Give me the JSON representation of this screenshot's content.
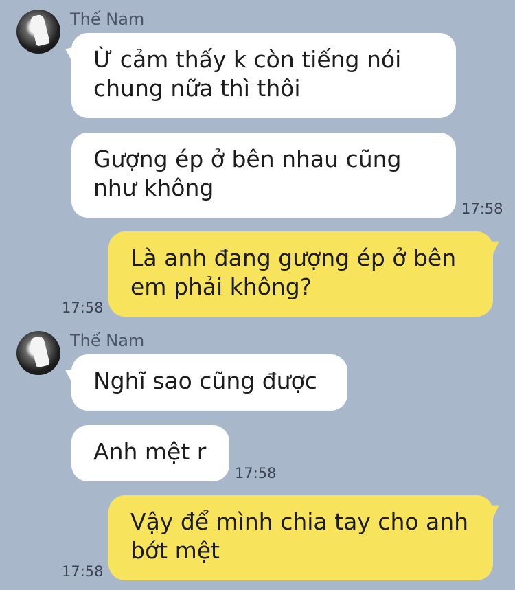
{
  "colors": {
    "background": "#a9b7cb",
    "incoming_bubble": "#ffffff",
    "outgoing_bubble": "#f8e45c"
  },
  "messages": [
    {
      "sender": "Thế Nam",
      "direction": "incoming",
      "text": "Ừ cảm thấy k còn tiếng nói chung nữa thì thôi"
    },
    {
      "direction": "incoming",
      "text": "Gượng ép ở bên nhau cũng như không",
      "time": "17:58"
    },
    {
      "direction": "outgoing",
      "text": "Là anh đang gượng ép ở bên em phải không?",
      "time": "17:58"
    },
    {
      "sender": "Thế Nam",
      "direction": "incoming",
      "text": "Nghĩ sao cũng được"
    },
    {
      "direction": "incoming",
      "text": "Anh mệt r",
      "time": "17:58"
    },
    {
      "direction": "outgoing",
      "text": "Vậy để mình chia tay cho anh bớt mệt",
      "time": "17:58"
    }
  ]
}
